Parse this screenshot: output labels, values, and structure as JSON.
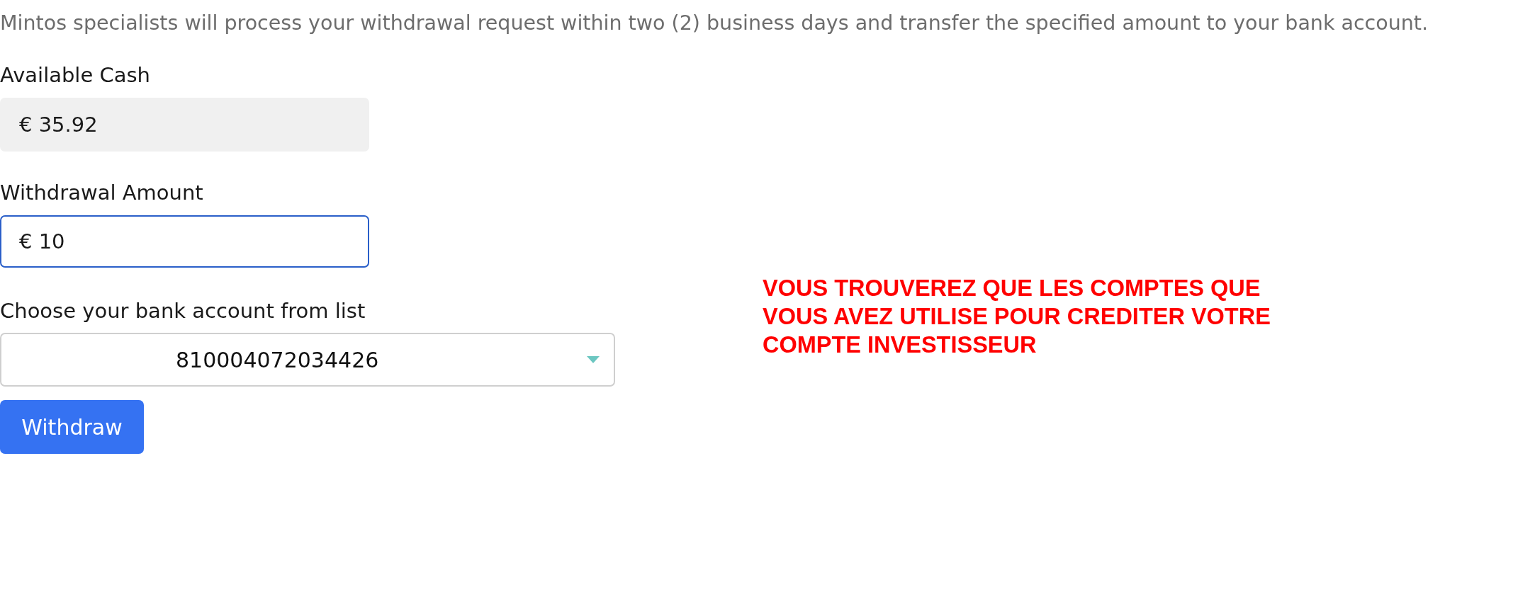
{
  "notice": "Mintos specialists will process your withdrawal request within two (2) business days and transfer the specified amount to your bank account.",
  "available_cash": {
    "label": "Available Cash",
    "value": "€ 35.92"
  },
  "withdrawal_amount": {
    "label": "Withdrawal Amount",
    "value": "€ 10",
    "focused": true
  },
  "bank_account": {
    "label": "Choose your bank account from list",
    "value": "810004072034426"
  },
  "withdraw_button": {
    "label": "Withdraw"
  },
  "annotation": {
    "text": "VOUS TROUVEREZ QUE LES COMPTES QUE\nVOUS AVEZ UTILISE POUR CREDITER VOTRE\nCOMPTE INVESTISSEUR"
  }
}
